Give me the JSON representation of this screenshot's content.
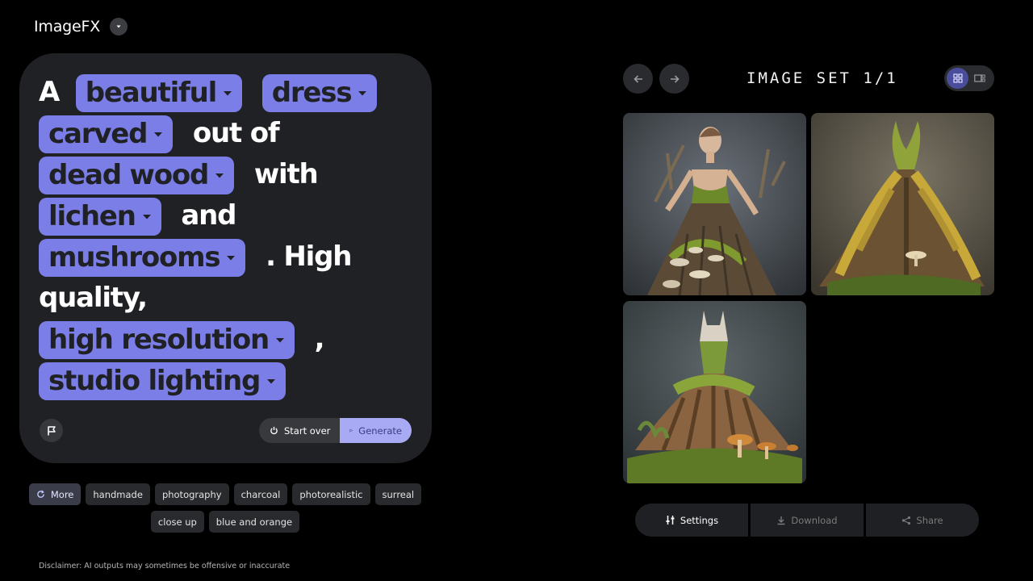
{
  "app": {
    "title": "ImageFX"
  },
  "prompt": {
    "segments": [
      {
        "type": "text",
        "value": "A"
      },
      {
        "type": "chip",
        "value": "beautiful"
      },
      {
        "type": "chip",
        "value": "dress"
      },
      {
        "type": "chip",
        "value": "carved"
      },
      {
        "type": "text",
        "value": "out of"
      },
      {
        "type": "chip",
        "value": "dead wood"
      },
      {
        "type": "text",
        "value": "with"
      },
      {
        "type": "chip",
        "value": "lichen"
      },
      {
        "type": "text",
        "value": "and"
      },
      {
        "type": "chip",
        "value": "mushrooms"
      },
      {
        "type": "text",
        "value": ". High quality,"
      },
      {
        "type": "chip",
        "value": "high resolution"
      },
      {
        "type": "text",
        "value": ","
      },
      {
        "type": "chip",
        "value": "studio lighting"
      }
    ],
    "start_over_label": "Start over",
    "generate_label": "Generate"
  },
  "suggestions": {
    "more_label": "More",
    "row1": [
      "handmade",
      "photography",
      "charcoal",
      "photorealistic",
      "surreal"
    ],
    "row2": [
      "close up",
      "blue and orange"
    ]
  },
  "disclaimer": "Disclaimer: AI outputs may sometimes be offensive or inaccurate",
  "image_set": {
    "title": "IMAGE SET 1/1",
    "view_options": [
      "grid-icon",
      "carousel-icon"
    ]
  },
  "actions": {
    "settings_label": "Settings",
    "download_label": "Download",
    "share_label": "Share"
  },
  "colors": {
    "chip": "#7b7ee6",
    "generate": "#a8abf4",
    "card": "#202124"
  }
}
